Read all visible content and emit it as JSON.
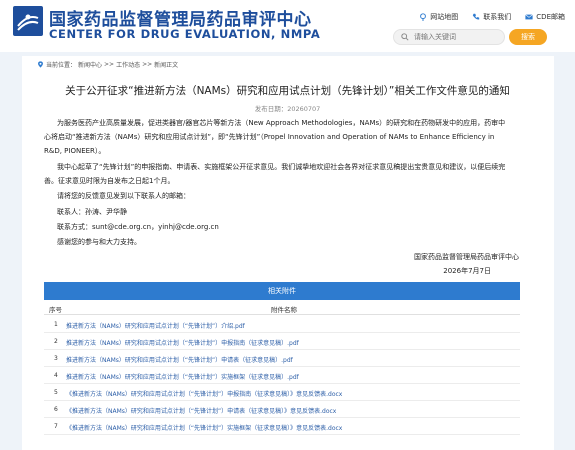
{
  "header": {
    "site_title_cn": "国家药品监督管理局药品审评中心",
    "site_title_en": "CENTER FOR DRUG EVALUATION, NMPA",
    "top_links": [
      {
        "label": "网站地图",
        "icon": "sitemap-icon"
      },
      {
        "label": "联系我们",
        "icon": "phone-icon"
      },
      {
        "label": "CDE邮箱",
        "icon": "mail-icon"
      }
    ],
    "search_placeholder": "请输入关键词",
    "search_button": "搜索"
  },
  "breadcrumb": {
    "prefix": "当前位置：",
    "items": [
      "新闻中心",
      "工作动态",
      "新闻正文"
    ],
    "separator": ">>"
  },
  "article": {
    "title": "关于公开征求“推进新方法（NAMs）研究和应用试点计划（先锋计划）”相关工作文件意见的通知",
    "published": "发布日期：20260707",
    "paragraphs": [
      "为服务医药产业高质量发展，促进类器官/器官芯片等新方法（New Approach Methodologies，NAMs）的研究和在药物研发中的应用，药审中",
      "心将启动“推进新方法（NAMs）研究和应用试点计划”，即“先锋计划”（Propel Innovation and Operation of NAMs to Enhance Efficiency in",
      "R&D, PIONEER）。",
      "我中心起草了“先锋计划”的申报指南、申请表、实施框架公开征求意见。我们诚挚地欢迎社会各界对征求意见稿提出宝贵意见和建议，以便后续完",
      "善。征求意见时限为自发布之日起1个月。",
      "请将您的反馈意见发到以下联系人的邮箱：",
      "联系人：孙涛、尹华静",
      "联系方式：sunt@cde.org.cn，yinhj@cde.org.cn",
      "感谢您的参与和大力支持。"
    ],
    "signature_org": "国家药品监督管理局药品审评中心",
    "signature_date": "2026年7月7日"
  },
  "attachments": {
    "heading": "相关附件",
    "col_index": "序号",
    "col_name": "附件名称",
    "rows": [
      {
        "num": "1",
        "name": "推进新方法（NAMs）研究和应用试点计划（“先锋计划”）介绍.pdf"
      },
      {
        "num": "2",
        "name": "推进新方法（NAMs）研究和应用试点计划（“先锋计划”）申报指南（征求意见稿）.pdf"
      },
      {
        "num": "3",
        "name": "推进新方法（NAMs）研究和应用试点计划（“先锋计划”）申请表（征求意见稿）.pdf"
      },
      {
        "num": "4",
        "name": "推进新方法（NAMs）研究和应用试点计划（“先锋计划”）实施框架（征求意见稿）.pdf"
      },
      {
        "num": "5",
        "name": "《推进新方法（NAMs）研究和应用试点计划（“先锋计划”）申报指南（征求意见稿）》意见反馈表.docx"
      },
      {
        "num": "6",
        "name": "《推进新方法（NAMs）研究和应用试点计划（“先锋计划”）申请表（征求意见稿）》意见反馈表.docx"
      },
      {
        "num": "7",
        "name": "《推进新方法（NAMs）研究和应用试点计划（“先锋计划”）实施框架（征求意见稿）》意见反馈表.docx"
      }
    ]
  },
  "colors": {
    "brand_blue": "#1e4e9c",
    "table_header": "#2e7bcf",
    "search_button": "#f5a623",
    "link": "#2d5fa8",
    "page_band": "#eef3f9"
  }
}
